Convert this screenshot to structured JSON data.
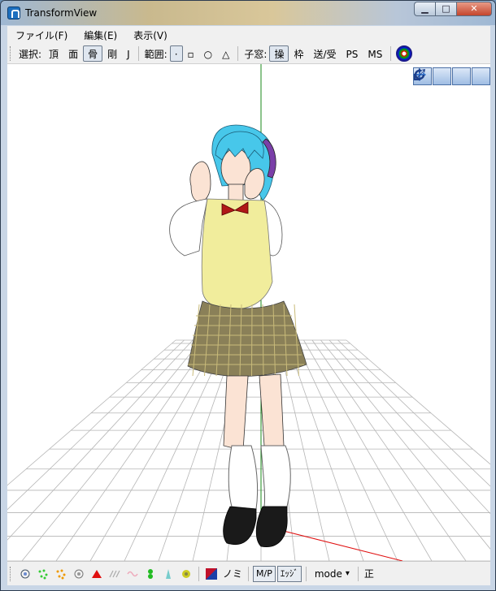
{
  "window": {
    "title": "TransformView",
    "controls": {
      "minimize": "▁",
      "maximize": "□",
      "close": "✕"
    }
  },
  "menubar": {
    "items": [
      {
        "label": "ファイル(F)"
      },
      {
        "label": "編集(E)"
      },
      {
        "label": "表示(V)"
      }
    ]
  },
  "toolbar": {
    "select_label": "選択:",
    "select_items": [
      "頂",
      "面",
      "骨",
      "剛",
      "J"
    ],
    "select_active": "骨",
    "range_label": "範囲:",
    "range_items": [
      "·",
      "▫",
      "○",
      "△"
    ],
    "range_active": "·",
    "child_label": "子窓:",
    "child_items": [
      "操",
      "枠",
      "送/受",
      "PS",
      "MS"
    ],
    "child_active": "操",
    "globe_icon": "globe-icon"
  },
  "viewport": {
    "nav_icons": [
      "move-xyz-icon",
      "move-xy-icon",
      "rotate-axis-icon",
      "refresh-icon"
    ]
  },
  "bottombar": {
    "icons": [
      "target-icon",
      "particles-green-icon",
      "particles-orange-icon",
      "circle-dot-icon",
      "red-triangle-icon",
      "hatch-icon",
      "wave-icon",
      "green-shape-icon",
      "teal-shape-icon",
      "yellow-star-icon"
    ],
    "color_icon": "color-square-icon",
    "nomi_label": "ノミ",
    "mp_label": "M/P",
    "edge_label": "ｴｯｼﾞ",
    "mode_label": "mode",
    "mode_arrow": "▾",
    "correct_label": "正"
  },
  "colors": {
    "grid": "#b5b5b5",
    "axis_y": "#1a8a1a",
    "axis_x": "#e01010",
    "hair": "#47c7ea",
    "vest": "#f1ed9c",
    "skirt": "#8a8058",
    "shirt": "#ffffff",
    "shoes": "#1a1a1a",
    "bow": "#b01818"
  }
}
